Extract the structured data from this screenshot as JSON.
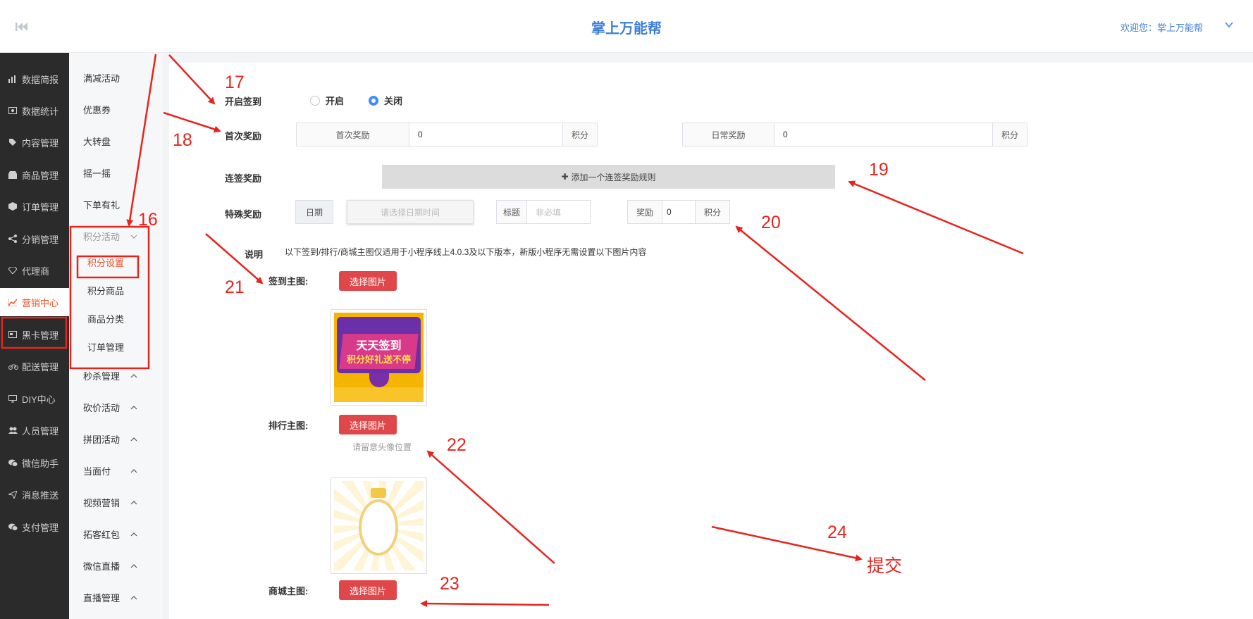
{
  "header": {
    "title": "掌上万能帮",
    "welcome": "欢迎您：掌上万能帮"
  },
  "sidebar": {
    "items": [
      {
        "label": "数据简报",
        "icon": "bar-chart-icon"
      },
      {
        "label": "数据统计",
        "icon": "money-icon"
      },
      {
        "label": "内容管理",
        "icon": "tag-icon"
      },
      {
        "label": "商品管理",
        "icon": "shop-icon"
      },
      {
        "label": "订单管理",
        "icon": "cube-icon"
      },
      {
        "label": "分销管理",
        "icon": "share-icon"
      },
      {
        "label": "代理商",
        "icon": "diamond-icon"
      },
      {
        "label": "营销中心",
        "icon": "line-chart-icon",
        "active": true
      },
      {
        "label": "黑卡管理",
        "icon": "card-icon"
      },
      {
        "label": "配送管理",
        "icon": "motorcycle-icon"
      },
      {
        "label": "DIY中心",
        "icon": "monitor-icon"
      },
      {
        "label": "人员管理",
        "icon": "users-icon"
      },
      {
        "label": "微信助手",
        "icon": "wechat-icon"
      },
      {
        "label": "消息推送",
        "icon": "send-icon"
      },
      {
        "label": "支付管理",
        "icon": "wechat-pay-icon"
      }
    ]
  },
  "submenu": {
    "items_top": [
      "满减活动",
      "优惠券",
      "大转盘",
      "摇一摇",
      "下单有礼"
    ],
    "group": "积分活动",
    "children": [
      "积分设置",
      "积分商品",
      "商品分类",
      "订单管理"
    ],
    "items_bottom": [
      "秒杀管理",
      "砍价活动",
      "拼团活动",
      "当面付",
      "视频营销",
      "拓客红包",
      "微信直播",
      "直播管理"
    ]
  },
  "form": {
    "signin_label": "开启签到",
    "radio_on": "开启",
    "radio_off": "关闭",
    "radio_selected": "关闭",
    "first_reward_label": "首次奖励",
    "first_reward_addon": "首次奖励",
    "first_reward_value": "0",
    "points_unit": "积分",
    "daily_reward_addon": "日常奖励",
    "daily_reward_value": "0",
    "streak_label": "连签奖励",
    "add_streak_rule": "添加一个连签奖励规则",
    "special_label": "特殊奖励",
    "date_addon": "日期",
    "date_placeholder": "请选择日期时间",
    "title_addon": "标题",
    "title_placeholder": "非必填",
    "reward_addon": "奖励",
    "reward_value": "0",
    "note_label": "说明",
    "note_text": "以下签到/排行/商城主图仅适用于小程序线上4.0.3及以下版本，新版小程序无需设置以下图片内容",
    "signin_img_label": "签到主图:",
    "rank_img_label": "排行主图:",
    "mall_img_label": "商城主图:",
    "choose_image": "选择图片",
    "avatar_hint": "请留意头像位置",
    "banner_line1": "天天签到",
    "banner_line2": "积分好礼送不停"
  },
  "annotations": {
    "n16": "16",
    "n17": "17",
    "n18": "18",
    "n19": "19",
    "n20": "20",
    "n21": "21",
    "n22": "22",
    "n23": "23",
    "n24": "24",
    "submit": "提交"
  },
  "colors": {
    "accent": "#3e7fd6",
    "active": "#e8542b",
    "button": "#e0474a",
    "annotation": "#e8231c"
  }
}
